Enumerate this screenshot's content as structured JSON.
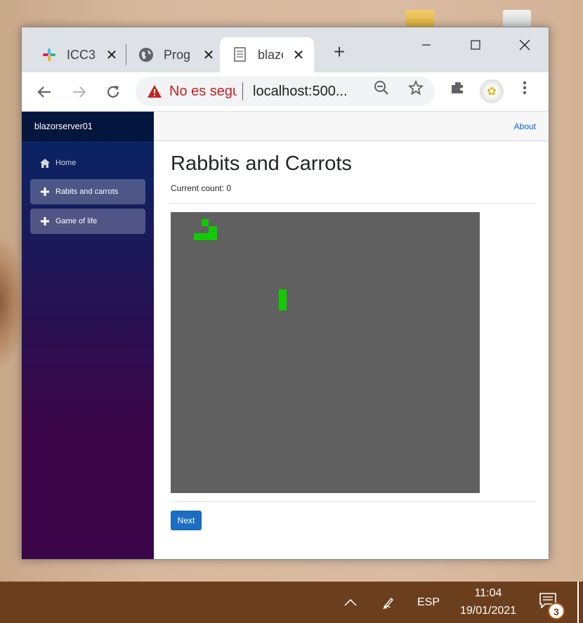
{
  "browser": {
    "tabs": [
      {
        "title": "ICC3",
        "icon": "slack-icon",
        "active": false
      },
      {
        "title": "Prog",
        "icon": "globe-icon",
        "active": false
      },
      {
        "title": "blazc",
        "icon": "page-icon",
        "active": true
      }
    ],
    "address": {
      "security_label": "No es segu",
      "url": "localhost:500..."
    }
  },
  "sidebar": {
    "brand": "blazorserver01",
    "items": [
      {
        "label": "Home",
        "icon": "home-icon",
        "active": false
      },
      {
        "label": "Rabits and carrots",
        "icon": "plus-icon",
        "active": true
      },
      {
        "label": "Game of life",
        "icon": "plus-icon",
        "active": false
      }
    ]
  },
  "header": {
    "about_label": "About"
  },
  "main": {
    "title": "Rabbits and Carrots",
    "count_label": "Current count:",
    "count_value": "0",
    "next_label": "Next"
  },
  "colors": {
    "board": "#606060",
    "cell": "#11cc00",
    "button": "#1b6ec2"
  },
  "taskbar": {
    "language": "ESP",
    "time": "11:04",
    "date": "19/01/2021",
    "notifications": "3"
  }
}
